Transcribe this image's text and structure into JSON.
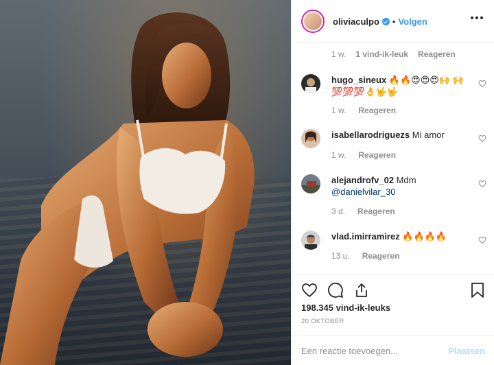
{
  "post": {
    "username": "oliviaculpo",
    "verified": true,
    "follow_label": "Volgen",
    "separator": "•"
  },
  "top_comment_meta": {
    "time": "1 w.",
    "likes": "1 vind-ik-leuk",
    "reply": "Reageren"
  },
  "comments": [
    {
      "username": "hugo_sineux",
      "text": "🔥🔥😍😍😍🙌 🙌💯💯💯👌🤟🤟",
      "time": "1 w.",
      "reply": "Reageren"
    },
    {
      "username": "isabellarodriguezs",
      "text": "Mi amor",
      "time": "1 w.",
      "reply": "Reageren"
    },
    {
      "username": "alejandrofv_02",
      "text": "Mdm",
      "mention": "@danielvilar_30",
      "time": "3 d.",
      "reply": "Reageren"
    },
    {
      "username": "vlad.imirramirez",
      "text": "🔥🔥🔥🔥",
      "time": "13 u.",
      "reply": "Reageren"
    }
  ],
  "actions": {
    "likes": "198.345 vind-ik-leuks",
    "date": "20 OKTOBER"
  },
  "add_comment": {
    "placeholder": "Een reactie toevoegen...",
    "post_label": "Plaatsen"
  },
  "colors": {
    "accent": "#3897f0",
    "text": "#262626",
    "muted": "#8e8e8e",
    "post_disabled": "#b2dffc"
  }
}
